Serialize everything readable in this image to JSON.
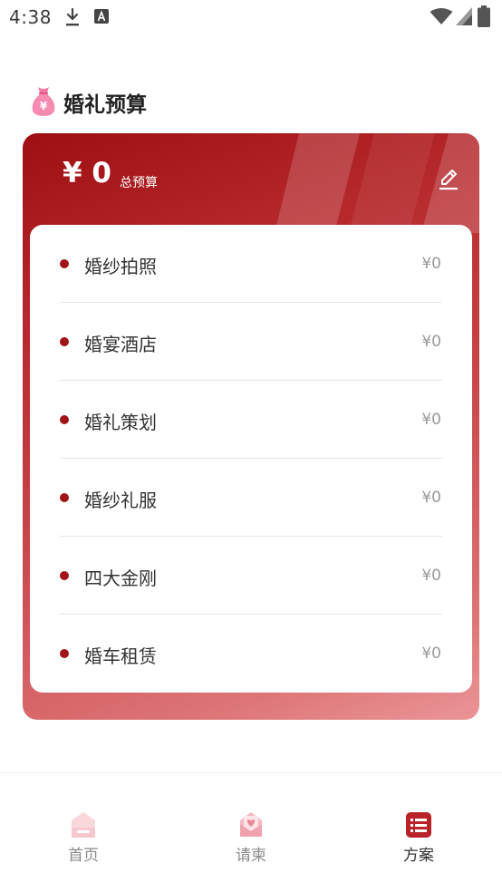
{
  "status_bar": {
    "time": "4:38",
    "icons": [
      "download-icon",
      "a-icon",
      "wifi-icon",
      "signal-icon",
      "battery-icon"
    ]
  },
  "header": {
    "title": "婚礼预算",
    "icon": "money-bag-icon"
  },
  "budget_card": {
    "total_amount": "¥ 0",
    "total_label": "总预算",
    "edit_icon": "edit-icon",
    "items": [
      {
        "name": "婚纱拍照",
        "amount": "¥0"
      },
      {
        "name": "婚宴酒店",
        "amount": "¥0"
      },
      {
        "name": "婚礼策划",
        "amount": "¥0"
      },
      {
        "name": "婚纱礼服",
        "amount": "¥0"
      },
      {
        "name": "四大金刚",
        "amount": "¥0"
      },
      {
        "name": "婚车租赁",
        "amount": "¥0"
      }
    ]
  },
  "bottom_nav": {
    "items": [
      {
        "label": "首页",
        "icon": "home-icon",
        "active": false
      },
      {
        "label": "请柬",
        "icon": "invitation-icon",
        "active": false
      },
      {
        "label": "方案",
        "icon": "plan-list-icon",
        "active": true
      }
    ]
  },
  "colors": {
    "accent": "#a01418",
    "card_gradient_start": "#9e0f12",
    "card_gradient_end": "#ea9597",
    "nav_inactive": "#8a8a8a",
    "nav_active": "#333333"
  }
}
